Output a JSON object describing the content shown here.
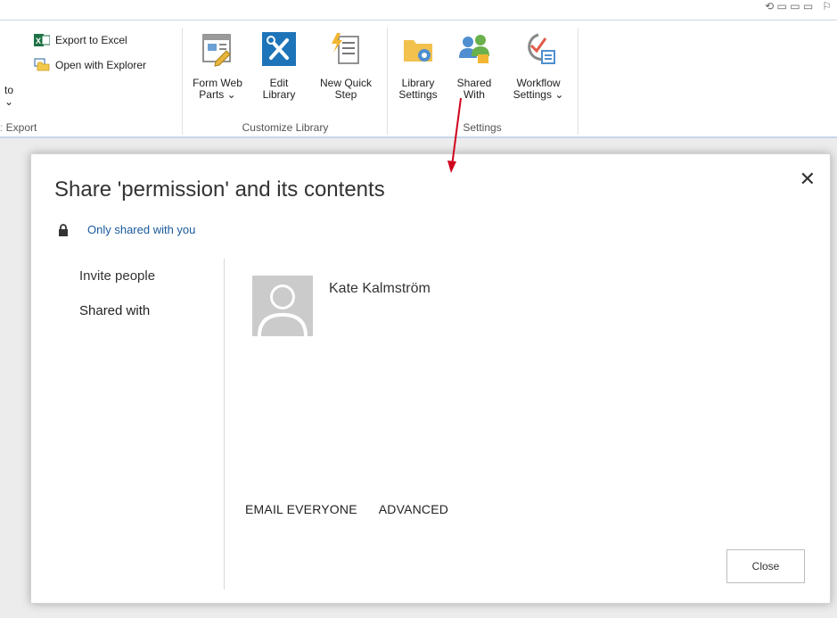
{
  "ribbon": {
    "export_group": {
      "export_to_excel": "Export to Excel",
      "open_with_explorer": "Open with Explorer",
      "cut_label": "to",
      "group_label": "ː Export"
    },
    "customize_group": {
      "form_web_parts": [
        "Form Web",
        "Parts ⌄"
      ],
      "edit_library": [
        "Edit",
        "Library"
      ],
      "new_quick_step": [
        "New Quick",
        "Step"
      ],
      "group_label": "Customize Library"
    },
    "settings_group": {
      "library_settings": [
        "Library",
        "Settings"
      ],
      "shared_with": [
        "Shared",
        "With"
      ],
      "workflow_settings": [
        "Workflow",
        "Settings ⌄"
      ],
      "group_label": "Settings"
    }
  },
  "dialog": {
    "title": "Share 'permission' and its contents",
    "close_glyph": "✕",
    "permission_text": "Only shared with you",
    "nav": [
      "Invite people",
      "Shared with"
    ],
    "person_name": "Kate Kalmström",
    "email_everyone": "EMAIL EVERYONE",
    "advanced": "ADVANCED",
    "close_button": "Close"
  },
  "colors": {
    "link": "#1a5a9c",
    "annotation_arrow": "#d0021b",
    "excel_green": "#1e7145",
    "edit_library_blue": "#1e74b8"
  }
}
